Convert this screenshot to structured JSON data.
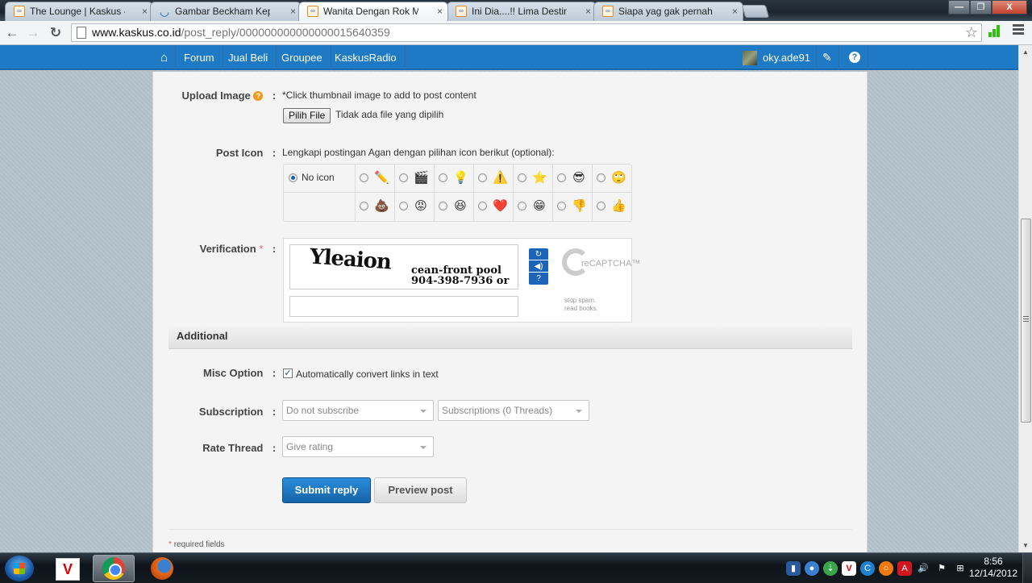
{
  "browser": {
    "tabs": [
      {
        "title": "The Lounge | Kaskus - The",
        "favicon": "kaskus-icon",
        "active": false
      },
      {
        "title": "Gambar Beckham Kepergo",
        "favicon": "loading-spinner-icon",
        "active": false
      },
      {
        "title": "Wanita Dengan Rok Mini D",
        "favicon": "kaskus-icon",
        "active": true
      },
      {
        "title": "Ini Dia....!! Lima Destinasi V",
        "favicon": "kaskus-icon",
        "active": false
      },
      {
        "title": "Siapa yag gak pernah min",
        "favicon": "kaskus-icon",
        "active": false
      }
    ],
    "tab_close_glyph": "×",
    "url_domain": "www.kaskus.co.id",
    "url_path": "/post_reply/000000000000000015640359",
    "window_controls": {
      "minimize": "—",
      "maximize": "❐",
      "close": "X"
    }
  },
  "site_nav": {
    "home_icon": "⌂",
    "items": [
      "Forum",
      "Jual Beli",
      "Groupee",
      "KaskusRadio"
    ],
    "username": "oky.ade91",
    "edit_icon": "✎",
    "help_icon": "?"
  },
  "form": {
    "upload_image": {
      "label": "Upload Image",
      "help_icon": "?",
      "hint": "*Click thumbnail image to add to post content",
      "file_button": "Pilih File",
      "file_status": "Tidak ada file yang dipilih"
    },
    "post_icon": {
      "label": "Post Icon",
      "instruction": "Lengkapi postingan Agan dengan pilihan icon berikut (optional):",
      "no_icon_label": "No icon",
      "selected": "No icon",
      "row1": [
        {
          "name": "pencil-icon",
          "glyph": "✏️"
        },
        {
          "name": "clapperboard-icon",
          "glyph": "🎬"
        },
        {
          "name": "lightbulb-icon",
          "glyph": "💡"
        },
        {
          "name": "warning-icon",
          "glyph": "⚠️"
        },
        {
          "name": "star-icon",
          "glyph": "⭐"
        },
        {
          "name": "cool-smiley-icon",
          "glyph": "😎"
        },
        {
          "name": "rolling-eyes-smiley-icon",
          "glyph": "🙄"
        }
      ],
      "row2": [
        {
          "name": "poop-icon",
          "glyph": "💩"
        },
        {
          "name": "angry-smiley-icon",
          "glyph": "😡"
        },
        {
          "name": "laughing-smiley-icon",
          "glyph": "😆"
        },
        {
          "name": "heart-icon",
          "glyph": "❤️"
        },
        {
          "name": "grin-smiley-icon",
          "glyph": "😁"
        },
        {
          "name": "thumbs-down-icon",
          "glyph": "👎"
        },
        {
          "name": "thumbs-up-icon",
          "glyph": "👍"
        }
      ]
    },
    "verification": {
      "label": "Verification",
      "required_mark": "*",
      "captcha_word1": "Yleaion",
      "captcha_word2_line1": "cean-front pool",
      "captcha_word2_line2": "904-398-7936 or",
      "captcha_input_value": "",
      "refresh_icon": "↻",
      "audio_icon": "◀)",
      "help_icon": "?",
      "brand": "reCAPTCHA™",
      "slogan_line1": "stop spam.",
      "slogan_line2": "read books."
    },
    "additional": {
      "section_title": "Additional",
      "misc_option": {
        "label": "Misc Option",
        "checkbox_label": "Automatically convert links in text",
        "checked": true
      },
      "subscription": {
        "label": "Subscription",
        "mode": "Do not subscribe",
        "folder": "Subscriptions (0 Threads)"
      },
      "rate_thread": {
        "label": "Rate Thread",
        "value": "Give rating"
      }
    },
    "colon": ":",
    "submit_button": "Submit reply",
    "preview_button": "Preview post",
    "required_note": "required fields",
    "required_star": "*"
  },
  "taskbar": {
    "apps": [
      "windows-start",
      "vnc-viewer",
      "google-chrome",
      "firefox"
    ],
    "tray_icons": [
      "network-drive-icon",
      "cloud-icon",
      "download-manager-icon",
      "vnc-icon",
      "ccleaner-icon",
      "avast-icon",
      "avira-icon",
      "volume-icon",
      "action-center-flag-icon",
      "network-icon"
    ],
    "time": "8:56",
    "date": "12/14/2012"
  }
}
